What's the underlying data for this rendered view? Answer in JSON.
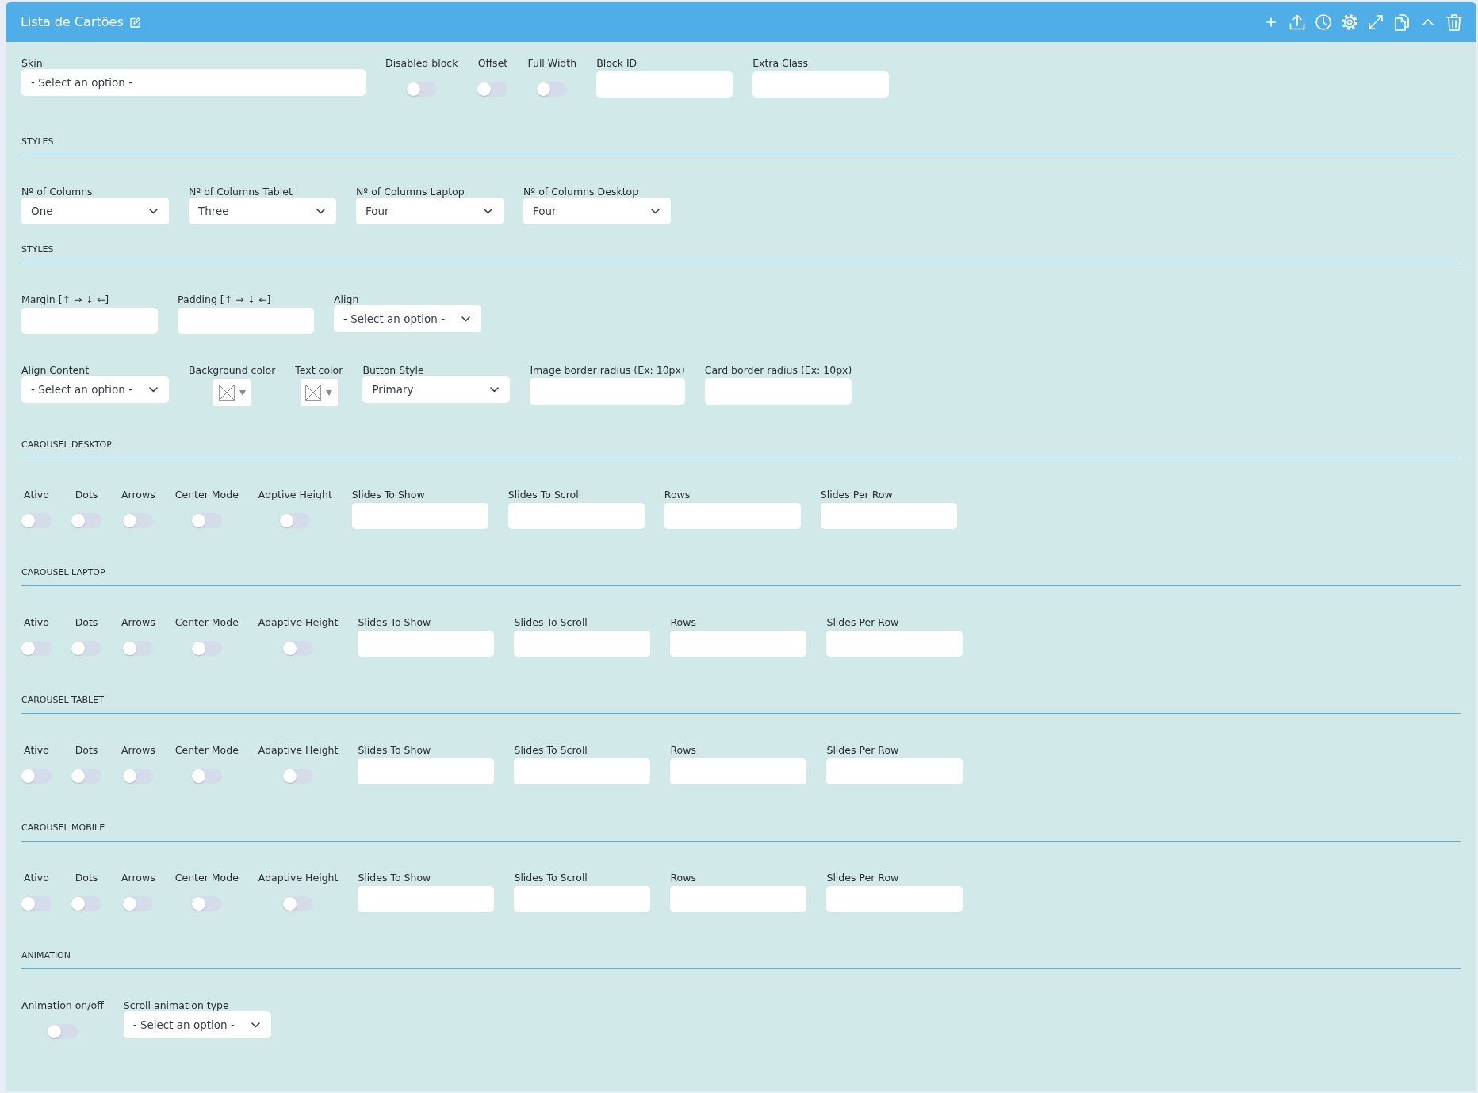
{
  "panel": {
    "title": "Lista de Cartões"
  },
  "top_fields": [
    {
      "kind": "combo",
      "label": "Skin",
      "value": "- Select an option -"
    },
    {
      "kind": "toggle",
      "label": "Disabled block",
      "on": false
    },
    {
      "kind": "toggle",
      "label": "Offset",
      "on": false
    },
    {
      "kind": "toggle",
      "label": "Full Width",
      "on": false
    },
    {
      "kind": "text",
      "label": "Block ID"
    },
    {
      "kind": "text",
      "label": "Extra Class"
    }
  ],
  "sections": [
    {
      "title": "STYLES",
      "groups": [
        {
          "fields": [
            {
              "kind": "select",
              "label": "Nº of Columns",
              "value": "One"
            },
            {
              "kind": "select",
              "label": "Nº of Columns Tablet",
              "value": "Three"
            },
            {
              "kind": "select",
              "label": "Nº of Columns Laptop",
              "value": "Four"
            },
            {
              "kind": "select",
              "label": "Nº of Columns Desktop",
              "value": "Four"
            }
          ]
        }
      ]
    },
    {
      "title": "STYLES",
      "groups": [
        {
          "fields": [
            {
              "kind": "text",
              "label": "Margin [↑ → ↓ ←]"
            },
            {
              "kind": "text",
              "label": "Padding [↑ → ↓ ←]"
            },
            {
              "kind": "select",
              "label": "Align",
              "value": "- Select an option -"
            }
          ]
        },
        {
          "fields": [
            {
              "kind": "select",
              "label": "Align Content",
              "value": "- Select an option -"
            },
            {
              "kind": "color",
              "label": "Background color"
            },
            {
              "kind": "color",
              "label": "Text color"
            },
            {
              "kind": "select",
              "label": "Button Style",
              "value": "Primary"
            },
            {
              "kind": "text",
              "label": "Image border radius (Ex: 10px)"
            },
            {
              "kind": "text",
              "label": "Card border radius (Ex: 10px)"
            }
          ]
        }
      ]
    },
    {
      "title": "CAROUSEL DESKTOP",
      "groups": [
        {
          "fields": [
            {
              "kind": "toggle",
              "label": "Ativo",
              "on": false
            },
            {
              "kind": "toggle",
              "label": "Dots",
              "on": false
            },
            {
              "kind": "toggle",
              "label": "Arrows",
              "on": false
            },
            {
              "kind": "toggle",
              "label": "Center Mode",
              "on": false
            },
            {
              "kind": "toggle",
              "label": "Adptive Height",
              "on": false
            },
            {
              "kind": "text",
              "label": "Slides To Show"
            },
            {
              "kind": "text",
              "label": "Slides To Scroll"
            },
            {
              "kind": "text",
              "label": "Rows"
            },
            {
              "kind": "text",
              "label": "Slides Per Row"
            }
          ]
        }
      ]
    },
    {
      "title": "CAROUSEL LAPTOP",
      "groups": [
        {
          "fields": [
            {
              "kind": "toggle",
              "label": "Ativo",
              "on": false
            },
            {
              "kind": "toggle",
              "label": "Dots",
              "on": false
            },
            {
              "kind": "toggle",
              "label": "Arrows",
              "on": false
            },
            {
              "kind": "toggle",
              "label": "Center Mode",
              "on": false
            },
            {
              "kind": "toggle",
              "label": "Adaptive Height",
              "on": false
            },
            {
              "kind": "text",
              "label": "Slides To Show"
            },
            {
              "kind": "text",
              "label": "Slides To Scroll"
            },
            {
              "kind": "text",
              "label": "Rows"
            },
            {
              "kind": "text",
              "label": "Slides Per Row"
            }
          ]
        }
      ]
    },
    {
      "title": "CAROUSEL TABLET",
      "groups": [
        {
          "fields": [
            {
              "kind": "toggle",
              "label": "Ativo",
              "on": false
            },
            {
              "kind": "toggle",
              "label": "Dots",
              "on": false
            },
            {
              "kind": "toggle",
              "label": "Arrows",
              "on": false
            },
            {
              "kind": "toggle",
              "label": "Center Mode",
              "on": false
            },
            {
              "kind": "toggle",
              "label": "Adaptive Height",
              "on": false
            },
            {
              "kind": "text",
              "label": "Slides To Show"
            },
            {
              "kind": "text",
              "label": "Slides To Scroll"
            },
            {
              "kind": "text",
              "label": "Rows"
            },
            {
              "kind": "text",
              "label": "Slides Per Row"
            }
          ]
        }
      ]
    },
    {
      "title": "CAROUSEL MOBILE",
      "groups": [
        {
          "fields": [
            {
              "kind": "toggle",
              "label": "Ativo",
              "on": false
            },
            {
              "kind": "toggle",
              "label": "Dots",
              "on": false
            },
            {
              "kind": "toggle",
              "label": "Arrows",
              "on": false
            },
            {
              "kind": "toggle",
              "label": "Center Mode",
              "on": false
            },
            {
              "kind": "toggle",
              "label": "Adaptive Height",
              "on": false
            },
            {
              "kind": "text",
              "label": "Slides To Show"
            },
            {
              "kind": "text",
              "label": "Slides To Scroll"
            },
            {
              "kind": "text",
              "label": "Rows"
            },
            {
              "kind": "text",
              "label": "Slides Per Row"
            }
          ]
        }
      ]
    },
    {
      "title": "ANIMATION",
      "groups": [
        {
          "fields": [
            {
              "kind": "toggle",
              "label": "Animation on/off",
              "on": false
            },
            {
              "kind": "select",
              "label": "Scroll animation type",
              "value": "- Select an option -"
            }
          ]
        }
      ]
    }
  ]
}
